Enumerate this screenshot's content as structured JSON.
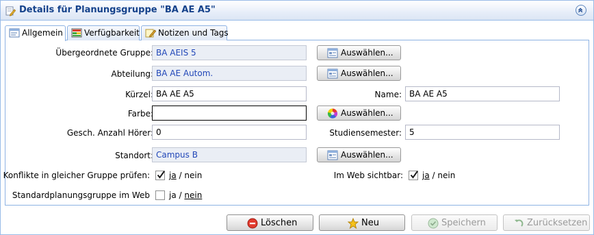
{
  "panel": {
    "title": "Details für Planungsgruppe \"BA AE A5\"",
    "collapse_icon": "double-chevron-up-icon"
  },
  "tabs": [
    {
      "label": "Allgemein",
      "icon": "form-icon",
      "active": true
    },
    {
      "label": "Verfügbarkeit",
      "icon": "calendar-grid-icon",
      "active": false
    },
    {
      "label": "Notizen und Tags",
      "icon": "note-pencil-icon",
      "active": false
    }
  ],
  "form": {
    "parent_group": {
      "label": "Übergeordnete Gruppe:",
      "value": "BA AEIS 5"
    },
    "department": {
      "label": "Abteilung:",
      "value": "BA AE Autom."
    },
    "short_name": {
      "label": "Kürzel:",
      "value": "BA AE A5"
    },
    "name": {
      "label": "Name:",
      "value": "BA AE A5"
    },
    "color": {
      "label": "Farbe:",
      "value": ""
    },
    "listeners": {
      "label": "Gesch. Anzahl Hörer:",
      "value": "0"
    },
    "semester": {
      "label": "Studiensemester:",
      "value": "5"
    },
    "location": {
      "label": "Standort:",
      "value": "Campus B"
    },
    "conflicts": {
      "label": "Konflikte in gleicher Gruppe prüfen:",
      "checked": true,
      "yes": "ja",
      "sep": "/",
      "no": "nein"
    },
    "web_visible": {
      "label": "Im Web sichtbar:",
      "checked": true,
      "yes": "ja",
      "sep": "/",
      "no": "nein"
    },
    "standard_web": {
      "label": "Standardplanungsgruppe im Web",
      "checked": false,
      "yes": "ja",
      "sep": "/",
      "no": "nein"
    },
    "select_label": "Auswählen..."
  },
  "footer": {
    "delete": "Löschen",
    "new": "Neu",
    "save": "Speichern",
    "reset": "Zurücksetzen"
  },
  "colors": {
    "title": "#15428b",
    "readonly_text": "#2147b8",
    "border": "#99bbe8"
  }
}
